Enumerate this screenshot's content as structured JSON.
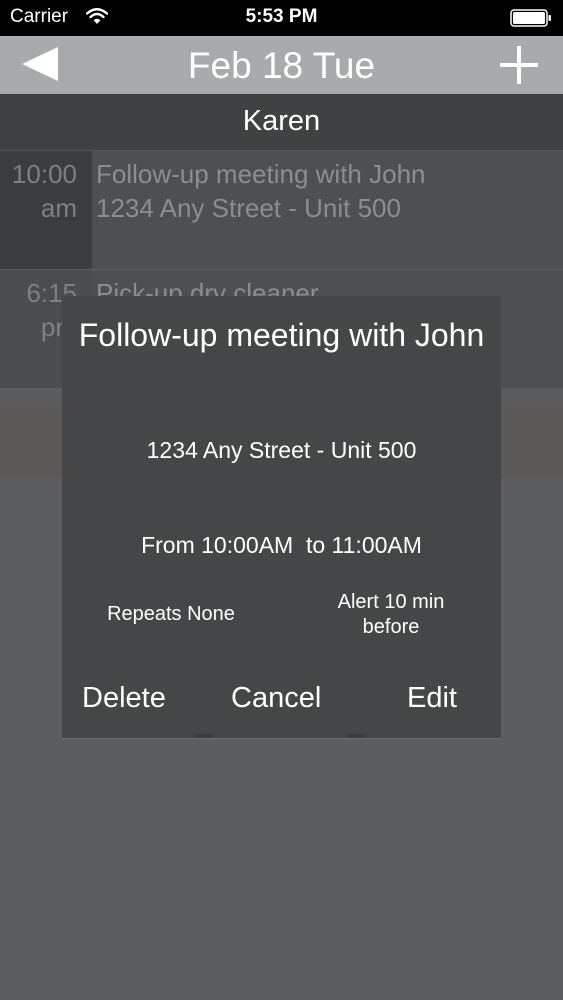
{
  "status_bar": {
    "carrier": "Carrier",
    "time": "5:53 PM",
    "wifi_icon": "wifi-icon",
    "battery_icon": "battery-full-icon"
  },
  "nav": {
    "title": "Feb 18 Tue",
    "back_icon": "back-triangle-icon",
    "add_icon": "plus-icon"
  },
  "header": {
    "name": "Karen"
  },
  "events": [
    {
      "time_hour": "10:00",
      "time_period": "am",
      "title": "Follow-up meeting with John",
      "location": "1234 Any Street - Unit 500"
    },
    {
      "time_hour": "6:15",
      "time_period": "pm",
      "title": "Pick-up dry cleaner",
      "location": ""
    }
  ],
  "popup": {
    "title": "Follow-up meeting with John",
    "address": "1234 Any Street - Unit 500",
    "time_range": "From 10:00AM  to 11:00AM",
    "repeats": "Repeats None",
    "alert": "Alert 10 min before",
    "buttons": {
      "delete": "Delete",
      "cancel": "Cancel",
      "edit": "Edit"
    }
  },
  "colors": {
    "background": "#5c5d60",
    "nav_bar": "#a9aaad",
    "header": "#3f4143",
    "popup": "#444648",
    "text": "#ffffff"
  }
}
